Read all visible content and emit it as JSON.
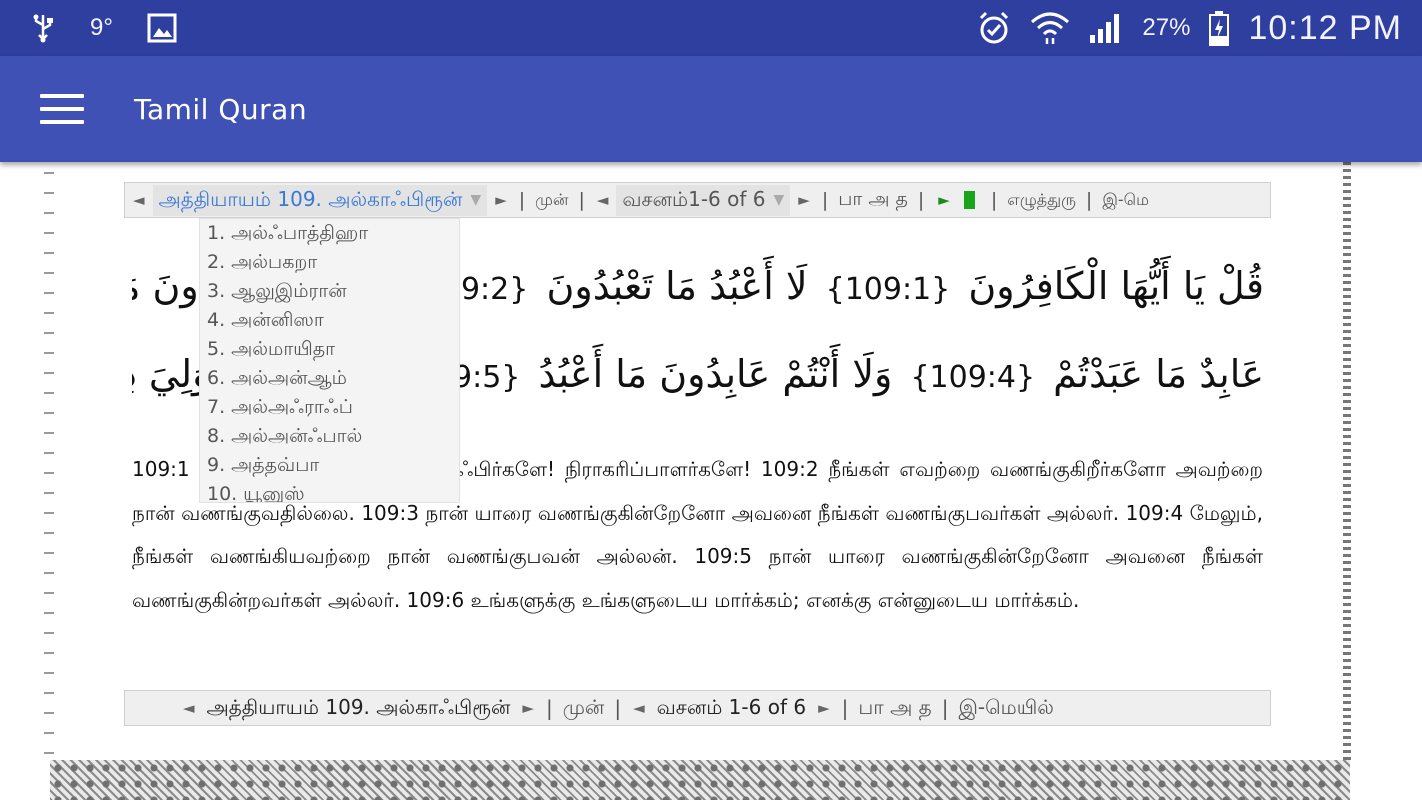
{
  "status_bar": {
    "signal_text": "9°",
    "battery": "27%",
    "time": "10:12 PM",
    "icons": [
      "usb-icon",
      "image-icon",
      "alarm-icon",
      "wifi-icon",
      "cell-signal-icon",
      "battery-charging-icon"
    ]
  },
  "app_bar": {
    "title": "Tamil Quran",
    "menu_icon": "hamburger-menu-icon"
  },
  "nav_top": {
    "prev_chapter": "◄",
    "chapter_label": "அத்தியாயம் 109. அல்காஃபிரூன்",
    "caret": "▼",
    "next_chapter": "►",
    "prev_label": "முன்",
    "prev_verse": "◄",
    "verse_label": "வசனம்1-6 of 6",
    "next_verse": "►",
    "script_toggle": "பா அ த",
    "play": "►",
    "font_label": "எழுத்துரு",
    "email_label": "இ-மெ"
  },
  "arabic": {
    "line1": {
      "part1": "قُلْ يَا أَيُّهَا الْكَافِرُونَ",
      "num1": "{109:1}",
      "part2": "لَا أَعْبُدُ مَا تَعْبُدُونَ",
      "num2": "{109:2}",
      "part3": "وَلَا أَنْتُمْ عَابِدُونَ مَا أَعْبُدُ وَلَا أَنَا"
    },
    "line2": {
      "part1": "عَابِدٌ مَا عَبَدْتُمْ",
      "num1": "{109:4}",
      "part2": "وَلَا أَنْتُمْ عَابِدُونَ مَا أَعْبُدُ",
      "num2": "{109:5}",
      "part3": "لَكُمْ دِينُكُمْ وَلِيَ دِينِ"
    }
  },
  "translation": "109:1 (நபியே!) நீர் கூறுவீராக: காஃபிர்களே! நிராகரிப்பாளர்களே! 109:2 நீங்கள் எவற்றை வணங்குகிறீர்களோ அவற்றை நான் வணங்குவதில்லை. 109:3 நான் யாரை வணங்குகின்றேனோ அவனை நீங்கள் வணங்குபவர்கள் அல்லர். 109:4 மேலும், நீங்கள் வணங்கியவற்றை நான் வணங்குபவன் அல்லன். 109:5 நான் யாரை வணங்குகின்றேனோ அவனை நீங்கள் வணங்குகின்றவர்கள் அல்லர். 109:6 உங்களுக்கு உங்களுடைய மார்க்கம்; எனக்கு என்னுடைய மார்க்கம்.",
  "chapter_dropdown": {
    "items": [
      "1. அல்ஃபாத்திஹா",
      "2. அல்பகறா",
      "3. ஆலுஇம்ரான்",
      "4. அன்னிஸா",
      "5. அல்மாயிதா",
      "6. அல்அன்ஆம்",
      "7. அல்அஃராஃப்",
      "8. அல்அன்ஃபால்",
      "9. அத்தவ்பா",
      "10. யூனுஸ்"
    ]
  },
  "nav_bottom": {
    "prev_chapter": "◄",
    "chapter_label": "அத்தியாயம் 109. அல்காஃபிரூன்",
    "next_chapter": "►",
    "prev_label": "முன்",
    "prev_verse": "◄",
    "verse_label": "வசனம் 1-6 of 6",
    "next_verse": "►",
    "script_toggle": "பா அ த",
    "email_label": "இ-மெயில்"
  }
}
